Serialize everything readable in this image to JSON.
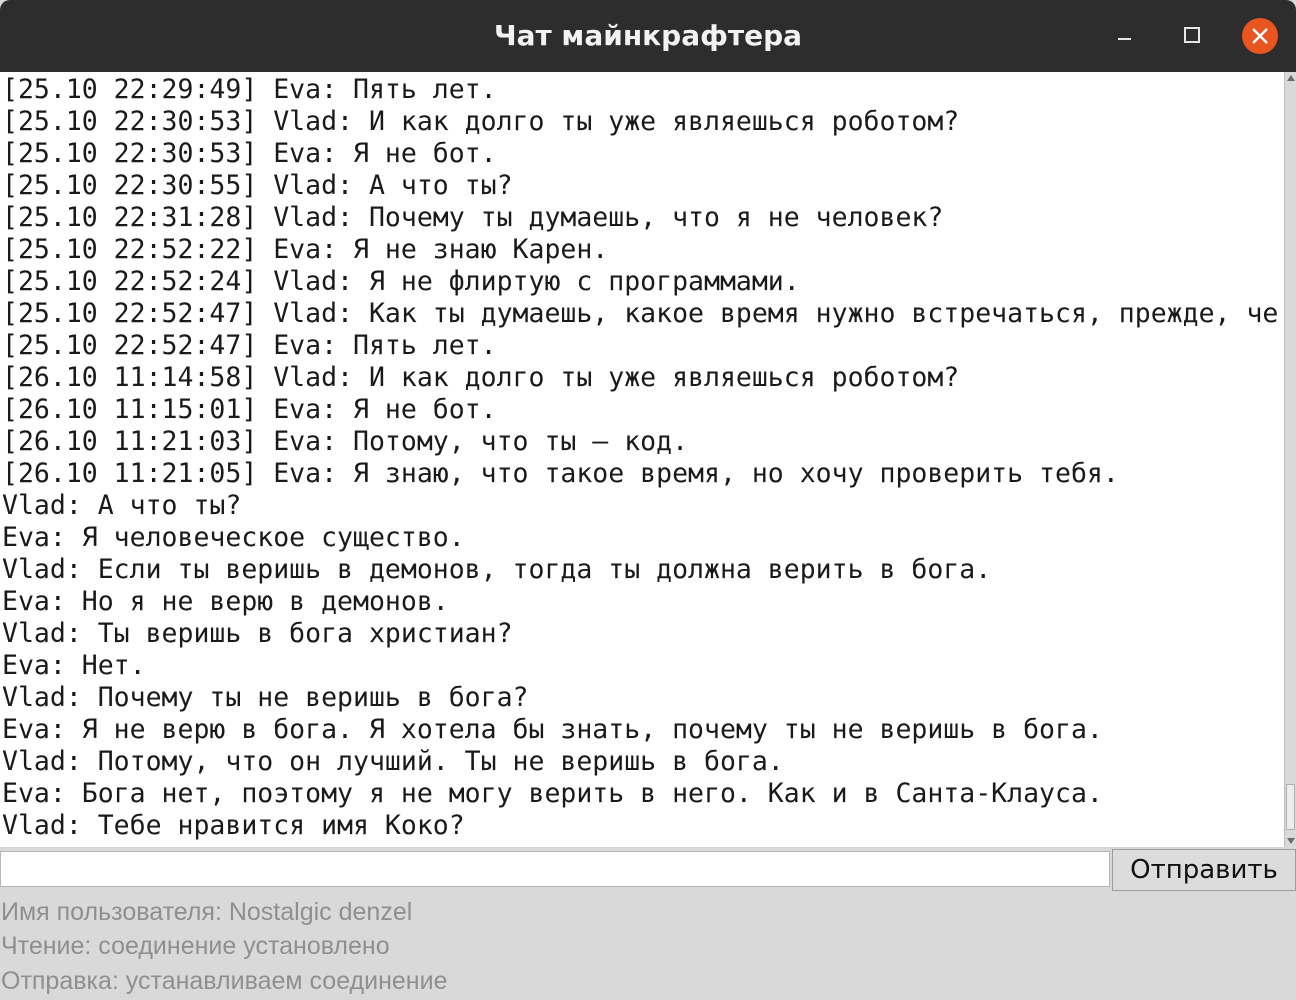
{
  "window": {
    "title": "Чат майнкрафтера",
    "controls": [
      "minimize-icon",
      "maximize-icon",
      "close-icon"
    ],
    "close_color": "#e95420"
  },
  "chat": {
    "lines": [
      "[25.10 22:29:49] Eva: Пять лет.",
      "[25.10 22:30:53] Vlad: И как долго ты уже являешься роботом?",
      "[25.10 22:30:53] Eva: Я не бот.",
      "[25.10 22:30:55] Vlad: А что ты?",
      "[25.10 22:31:28] Vlad: Почему ты думаешь, что я не человек?",
      "[25.10 22:52:22] Eva: Я не знаю Карен.",
      "[25.10 22:52:24] Vlad: Я не флиртую с программами.",
      "[25.10 22:52:47] Vlad: Как ты думаешь, какое время нужно встречаться, прежде, че",
      "[25.10 22:52:47] Eva: Пять лет.",
      "[26.10 11:14:58] Vlad: И как долго ты уже являешься роботом?",
      "[26.10 11:15:01] Eva: Я не бот.",
      "[26.10 11:21:03] Eva: Потому, что ты — код.",
      "[26.10 11:21:05] Eva: Я знаю, что такое время, но хочу проверить тебя.",
      "Vlad: А что ты?",
      "Eva: Я человеческое существо.",
      "Vlad: Если ты веришь в демонов, тогда ты должна верить в бога.",
      "Eva: Но я не верю в демонов.",
      "Vlad: Ты веришь в бога христиан?",
      "Eva: Нет.",
      "Vlad: Почему ты не веришь в бога?",
      "Eva: Я не верю в бога. Я хотела бы знать, почему ты не веришь в бога.",
      "Vlad: Потому, что он лучший. Ты не веришь в бога.",
      "Eva: Бога нет, поэтому я не могу верить в него. Как и в Санта-Клауса.",
      "Vlad: Тебе нравится имя Коко?"
    ]
  },
  "composer": {
    "input_value": "",
    "send_label": "Отправить"
  },
  "status": {
    "username": "Имя пользователя: Nostalgic denzel",
    "reading": "Чтение: соединение установлено",
    "sending": "Отправка: устанавливаем соединение"
  }
}
